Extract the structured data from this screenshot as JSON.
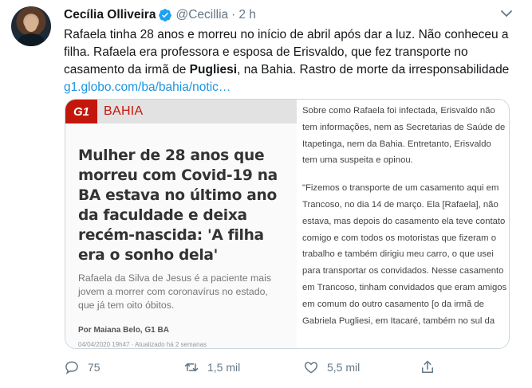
{
  "tweet": {
    "author_name": "Cecília Olliveira",
    "handle": "@Cecillia",
    "separator": "·",
    "time": "2 h",
    "text_part1": "Rafaela tinha 28 anos e morreu no início de abril após dar a luz. Não conheceu a filha. Rafaela era professora e esposa de Erisvaldo, que fez transporte no casamento da irmã de ",
    "text_bold": "Pugliesi",
    "text_part2": ", na Bahia. Rastro de morte da irresponsabilidade ",
    "link_text": "g1.globo.com/ba/bahia/notic…"
  },
  "card": {
    "logo": "G1",
    "section": "BAHIA",
    "headline": "Mulher de 28 anos que morreu com Covid-19 na BA estava no último ano da faculdade e deixa recém-nascida: 'A filha era o sonho dela'",
    "summary": "Rafaela da Silva de Jesus é a paciente mais jovem a morrer com coronavírus no estado, que já tem oito óbitos.",
    "byline": "Por Maiana Belo, G1 BA",
    "dateline": "04/04/2020 19h47 · Atualizado há 2 semanas",
    "paragraph1": "Sobre como Rafaela foi infectada, Erisvaldo não tem informações, nem as Secretarias de Saúde de Itapetinga, nem da Bahia. Entretanto, Erisvaldo tem uma suspeita e opinou.",
    "paragraph2": "\"Fizemos o transporte de um casamento aqui em Trancoso, no dia 14 de março. Ela [Rafaela], não estava, mas depois do casamento ela teve contato comigo e com todos os motoristas que fizeram o trabalho e também dirigiu meu carro, o que usei para transportar os convidados. Nesse casamento em Trancoso, tinham convidados que eram amigos em comum do outro casamento [o da irmã de Gabriela Pugliesi, em Itacaré, também no sul da"
  },
  "actions": {
    "reply_count": "75",
    "retweet_count": "1,5 mil",
    "like_count": "5,5 mil"
  },
  "colors": {
    "accent": "#1b95e0",
    "g1_red": "#c4170c",
    "muted": "#657786"
  },
  "icons": [
    "verified-badge-icon",
    "chevron-down-icon",
    "reply-icon",
    "retweet-icon",
    "like-icon",
    "share-icon"
  ]
}
